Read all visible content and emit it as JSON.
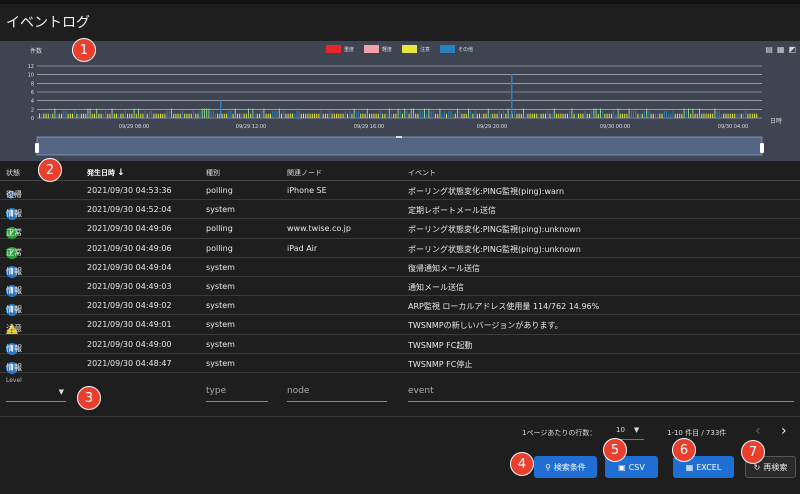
{
  "page": {
    "title": "イベントログ"
  },
  "badges": [
    "1",
    "2",
    "3",
    "4",
    "5",
    "6",
    "7"
  ],
  "chart_data": {
    "type": "bar",
    "ylabel": "件数",
    "xlabel": "日時",
    "ylim": [
      0,
      12
    ],
    "yticks": [
      "0",
      "2",
      "4",
      "6",
      "8",
      "10",
      "12"
    ],
    "xticks": [
      "09/29 08:00",
      "09/29 12:00",
      "09/29 16:00",
      "09/29 20:00",
      "09/30 00:00",
      "09/30 04:00"
    ],
    "series": [
      {
        "name": "重度",
        "color": "#e8262a"
      },
      {
        "name": "軽度",
        "color": "#f4a2a8"
      },
      {
        "name": "注意",
        "color": "#e8e43a"
      },
      {
        "name": "その他",
        "color": "#2d7fc1"
      }
    ]
  },
  "chart_tools": [
    "▤",
    "▦",
    "◩"
  ],
  "table": {
    "headers": [
      "状態",
      "発生日時",
      "種別",
      "関連ノード",
      "イベント"
    ],
    "sort_indicator": "↓",
    "rows": [
      {
        "icon": "rec",
        "state": "復帰",
        "time": "2021/09/30 04:53:36",
        "type": "polling",
        "node": "iPhone SE",
        "event": "ポーリング状態変化:PING監視(ping):warn"
      },
      {
        "icon": "info",
        "state": "情報",
        "time": "2021/09/30 04:52:04",
        "type": "system",
        "node": "",
        "event": "定期レポートメール送信"
      },
      {
        "icon": "ok",
        "state": "正常",
        "time": "2021/09/30 04:49:06",
        "type": "polling",
        "node": "www.twise.co.jp",
        "event": "ポーリング状態変化:PING監視(ping):unknown"
      },
      {
        "icon": "ok",
        "state": "正常",
        "time": "2021/09/30 04:49:06",
        "type": "polling",
        "node": "iPad Air",
        "event": "ポーリング状態変化:PING監視(ping):unknown"
      },
      {
        "icon": "info",
        "state": "情報",
        "time": "2021/09/30 04:49:04",
        "type": "system",
        "node": "",
        "event": "復帰通知メール送信"
      },
      {
        "icon": "info",
        "state": "情報",
        "time": "2021/09/30 04:49:03",
        "type": "system",
        "node": "",
        "event": "通知メール送信"
      },
      {
        "icon": "info",
        "state": "情報",
        "time": "2021/09/30 04:49:02",
        "type": "system",
        "node": "",
        "event": "ARP監視 ローカルアドレス使用量 114/762 14.96%"
      },
      {
        "icon": "warn",
        "state": "注意",
        "time": "2021/09/30 04:49:01",
        "type": "system",
        "node": "",
        "event": "TWSNMPの新しいバージョンがあります。"
      },
      {
        "icon": "info",
        "state": "情報",
        "time": "2021/09/30 04:49:00",
        "type": "system",
        "node": "",
        "event": "TWSNMP FC起動"
      },
      {
        "icon": "info",
        "state": "情報",
        "time": "2021/09/30 04:48:47",
        "type": "system",
        "node": "",
        "event": "TWSNMP FC停止"
      }
    ]
  },
  "filters": {
    "level_label": "Level",
    "type_placeholder": "type",
    "node_placeholder": "node",
    "event_placeholder": "event"
  },
  "pager": {
    "rows_per_page_label": "1ページあたりの行数：",
    "rows_per_page": "10",
    "range": "1-10 件目 / 733件",
    "prev": "‹",
    "next": "›"
  },
  "buttons": {
    "search": "検索条件",
    "csv": "CSV",
    "excel": "EXCEL",
    "reload": "再検索"
  }
}
